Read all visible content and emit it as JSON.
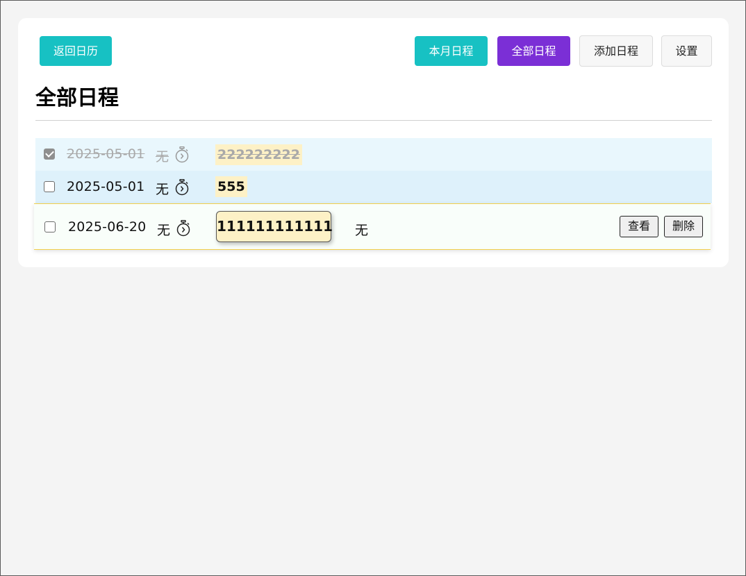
{
  "header": {
    "back_label": "返回日历",
    "month_label": "本月日程",
    "all_label": "全部日程",
    "add_label": "添加日程",
    "settings_label": "设置"
  },
  "page_title": "全部日程",
  "rows": [
    {
      "date": "2025-05-01",
      "reminder": "无",
      "title": "222222222",
      "checked": true
    },
    {
      "date": "2025-05-01",
      "reminder": "无",
      "title": "555",
      "checked": false
    },
    {
      "date": "2025-06-20",
      "reminder": "无",
      "title": "111111111111",
      "note": "无",
      "checked": false,
      "view_label": "查看",
      "delete_label": "删除"
    }
  ],
  "icons": {
    "timer": "stopwatch-icon",
    "checkbox_checked": "checkbox-checked-icon",
    "checkbox": "checkbox-icon"
  },
  "colors": {
    "teal": "#17c1c3",
    "purple": "#7b2fd6",
    "tag_bg": "#fdf1c6",
    "row_done_bg": "#e9f7fd",
    "row_bg": "#def1fb",
    "hover_border": "#f2cf4b"
  }
}
